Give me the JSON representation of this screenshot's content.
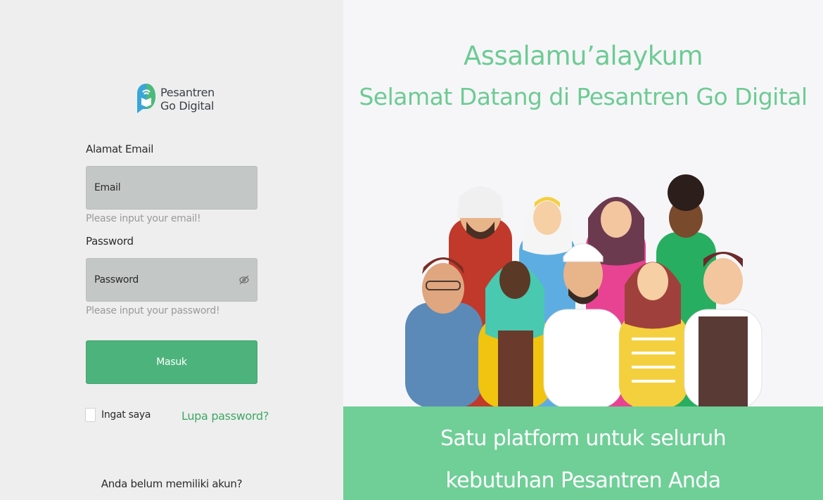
{
  "brand": {
    "line1": "Pesantren",
    "line2": "Go Digital"
  },
  "login": {
    "email_label": "Alamat Email",
    "email_placeholder": "Email",
    "email_hint": "Please input your email!",
    "password_label": "Password",
    "password_placeholder": "Password",
    "password_hint": "Please input your password!",
    "submit_label": "Masuk",
    "remember_label": "Ingat saya",
    "forgot_label": "Lupa password?",
    "signup_prompt": "Anda belum memiliki akun?"
  },
  "welcome": {
    "greeting": "Assalamu’alaykum",
    "title": "Selamat Datang di Pesantren Go Digital",
    "tagline_line1": "Satu platform untuk seluruh",
    "tagline_line2": "kebutuhan Pesantren Anda"
  },
  "colors": {
    "accent": "#6fcf97",
    "button": "#4db37c",
    "link": "#3ea866"
  },
  "icons": {
    "password_toggle": "eye-off-icon",
    "logo": "pesantren-logo-icon"
  }
}
